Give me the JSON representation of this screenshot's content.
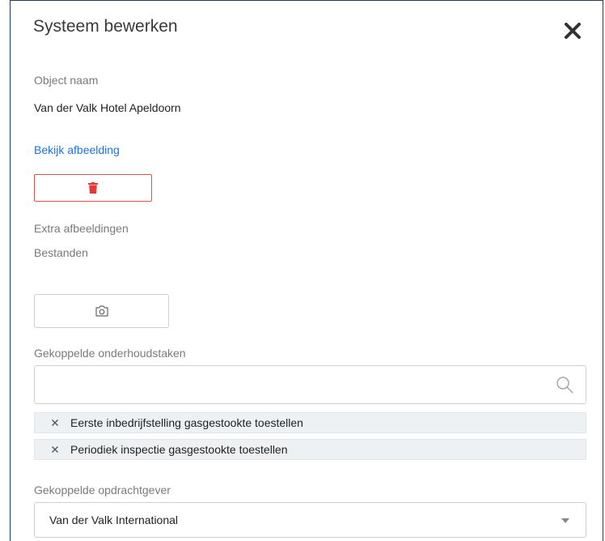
{
  "dialog": {
    "title": "Systeem bewerken",
    "close_icon": "close-icon"
  },
  "object": {
    "name_label": "Object naam",
    "name_value": "Van der Valk Hotel Apeldoorn",
    "view_image_link": "Bekijk afbeelding",
    "delete_icon": "trash-icon"
  },
  "images": {
    "extra_label": "Extra afbeeldingen",
    "files_label": "Bestanden",
    "camera_icon": "camera-icon"
  },
  "tasks": {
    "label": "Gekoppelde onderhoudstaken",
    "search_placeholder": "",
    "search_icon": "search-icon",
    "items": [
      {
        "label": "Eerste inbedrijfstelling gasgestookte toestellen"
      },
      {
        "label": "Periodiek inspectie gasgestookte toestellen"
      }
    ]
  },
  "client": {
    "label": "Gekoppelde opdrachtgever",
    "selected": "Van der Valk International"
  },
  "colors": {
    "link": "#1a73e8",
    "danger": "#d9534f",
    "border_dark": "#1f3b57"
  }
}
